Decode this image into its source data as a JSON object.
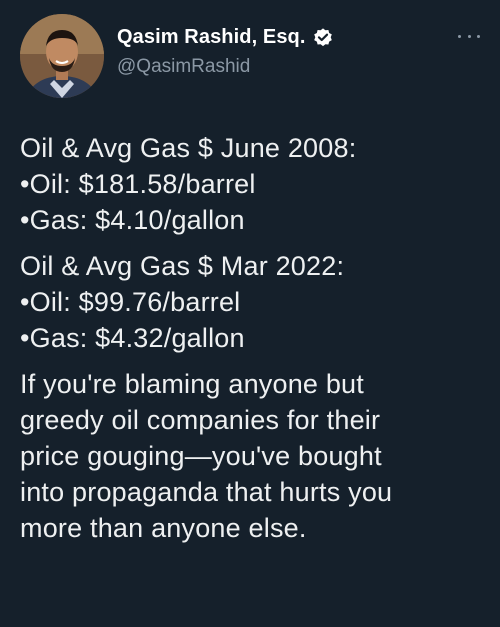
{
  "author": {
    "display_name": "Qasim Rashid, Esq.",
    "handle": "@QasimRashid",
    "verified_icon": "verified-badge-icon",
    "avatar_icon": "profile-photo"
  },
  "more_icon": "more-horizontal-icon",
  "tweet": {
    "block1": {
      "heading": "Oil & Avg Gas $ June 2008:",
      "oil": "•Oil: $181.58/barrel",
      "gas": "•Gas: $4.10/gallon"
    },
    "block2": {
      "heading": "Oil & Avg Gas $ Mar 2022:",
      "oil": "•Oil: $99.76/barrel",
      "gas": "•Gas: $4.32/gallon"
    },
    "closing_lines": [
      "If you're blaming anyone but",
      "greedy oil companies for their",
      "price gouging—you've bought",
      "into propaganda that hurts you",
      "more than anyone else."
    ]
  },
  "colors": {
    "background": "#15202b",
    "text": "#e7e9ea",
    "secondary": "#8b98a5"
  }
}
